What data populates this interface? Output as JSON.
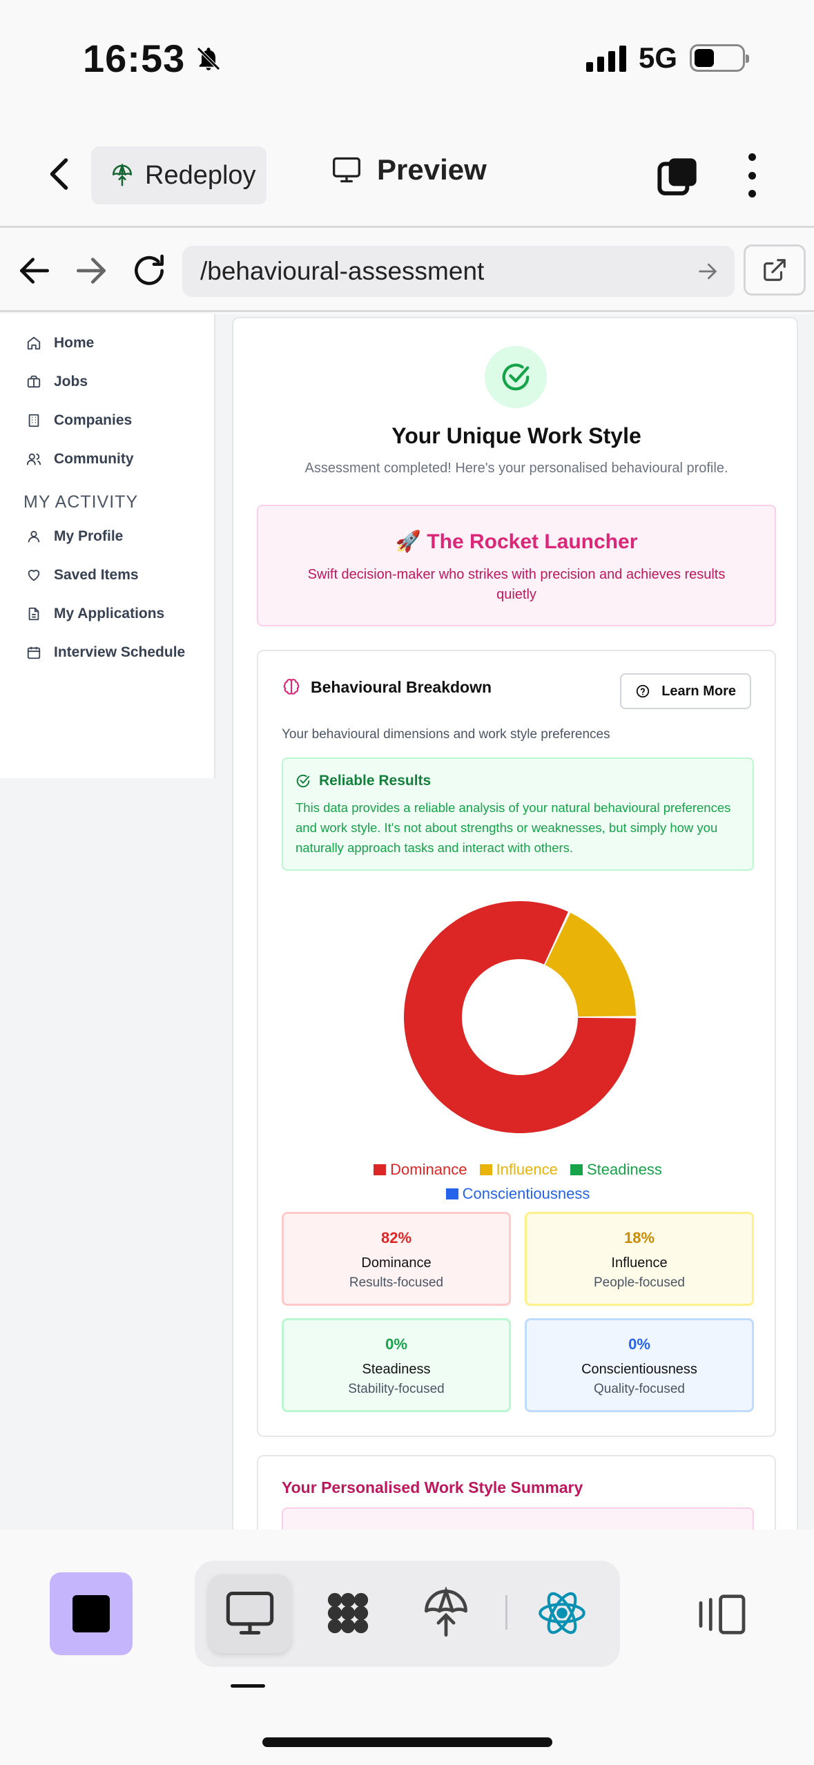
{
  "status_bar": {
    "time": "16:53",
    "network": "5G"
  },
  "header": {
    "redeploy_label": "Redeploy",
    "preview_label": "Preview"
  },
  "browser": {
    "url": "/behavioural-assessment"
  },
  "sidebar": {
    "items": [
      {
        "label": "Home",
        "icon": "home-icon"
      },
      {
        "label": "Jobs",
        "icon": "briefcase-icon"
      },
      {
        "label": "Companies",
        "icon": "building-icon"
      },
      {
        "label": "Community",
        "icon": "users-icon"
      }
    ],
    "section_title": "MY ACTIVITY",
    "activity_items": [
      {
        "label": "My Profile",
        "icon": "user-icon"
      },
      {
        "label": "Saved Items",
        "icon": "heart-icon"
      },
      {
        "label": "My Applications",
        "icon": "file-icon"
      },
      {
        "label": "Interview Schedule",
        "icon": "calendar-icon"
      }
    ]
  },
  "result": {
    "title": "Your Unique Work Style",
    "subtitle": "Assessment completed! Here's your personalised behavioural profile.",
    "persona_title": "🚀 The Rocket Launcher",
    "persona_desc": "Swift decision-maker who strikes with precision and achieves results quietly"
  },
  "breakdown": {
    "title": "Behavioural Breakdown",
    "learn_more": "Learn More",
    "description": "Your behavioural dimensions and work style preferences",
    "reliable_title": "Reliable Results",
    "reliable_text": "This data provides a reliable analysis of your natural behavioural preferences and work style. It's not about strengths or weaknesses, but simply how you naturally approach tasks and interact with others."
  },
  "chart_data": {
    "type": "pie",
    "donut": true,
    "categories": [
      "Dominance",
      "Influence",
      "Steadiness",
      "Conscientiousness"
    ],
    "values": [
      82,
      18,
      0,
      0
    ],
    "colors": [
      "#dc2626",
      "#eab308",
      "#16a34a",
      "#2563eb"
    ],
    "legend": "bottom"
  },
  "stats": [
    {
      "pct": "82%",
      "name": "Dominance",
      "desc": "Results-focused"
    },
    {
      "pct": "18%",
      "name": "Influence",
      "desc": "People-focused"
    },
    {
      "pct": "0%",
      "name": "Steadiness",
      "desc": "Stability-focused"
    },
    {
      "pct": "0%",
      "name": "Conscientiousness",
      "desc": "Quality-focused"
    }
  ],
  "summary": {
    "title": "Your Personalised Work Style Summary"
  }
}
